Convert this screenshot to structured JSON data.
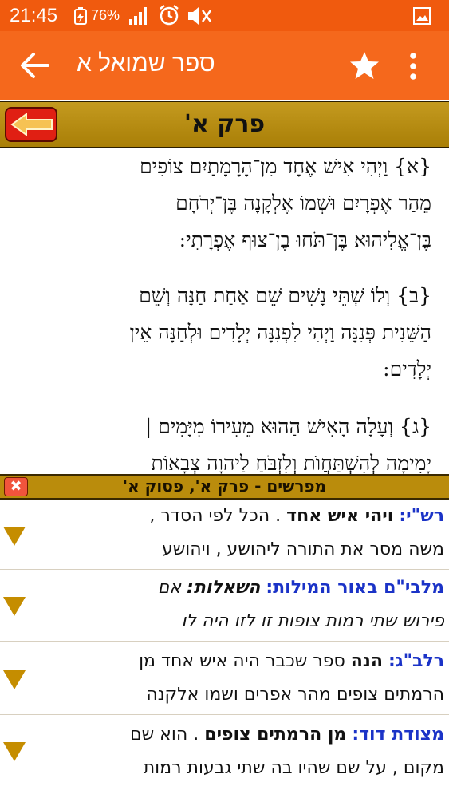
{
  "status_bar": {
    "time": "21:45",
    "battery": "76%"
  },
  "app_bar": {
    "title": "ספר שמואל א"
  },
  "chapter_bar": {
    "title": "פרק א'"
  },
  "verses": [
    {
      "lines": [
        "{א} וַיְהִי אִישׁ אֶחָד מִן־הָרָמָתַיִם צוֹפִים",
        "מֵהַר אֶפְרָיִם וּשְׁמוֹ אֶלְקָנָה בֶּן־יְרֹחָם",
        "בֶּן־אֱלִיהוּא בֶּן־תֹּחוּ בֶן־צוּף אֶפְרָתִי:"
      ]
    },
    {
      "lines": [
        "{ב} וְלוֹ שְׁתֵּי נָשִׁים שֵׁם אַחַת חַנָּה וְשֵׁם",
        "הַשֵּׁנִית פְּנִנָּה וַיְהִי לִפְנִנָּה יְלָדִים וּלְחַנָּה אֵין",
        "יְלָדִים:"
      ]
    },
    {
      "lines": [
        "{ג} וְעָלָה הָאִישׁ הַהוּא מֵעִירוֹ מִיָּמִים |",
        "יָמִימָה לְהִשְׁתַּחֲוֺת וְלִזְבֹּחַ לַיהוָה צְבָאוֹת"
      ]
    }
  ],
  "commentary_bar": {
    "title": "מפרשים - פרק א', פסוק א'"
  },
  "commentaries": [
    {
      "author": "רש\"י:",
      "headword": "ויהי איש אחד",
      "line1_rest": ". הכל לפי הסדר ,",
      "line2": "משה מסר את התורה ליהושע , ויהושע"
    },
    {
      "author": "מלבי\"ם באור המילות:",
      "headword": "השאלות:",
      "line1_rest": "אם",
      "line2": "פירוש שתי רמות צופות זו לזו היה לו"
    },
    {
      "author": "רלב\"ג:",
      "headword": "הנה",
      "line1_rest": "ספר שכבר היה איש אחד מן",
      "line2": "הרמתים צופים מהר אפרים ושמו אלקנה"
    },
    {
      "author": "מצודת דוד:",
      "headword": "מן הרמתים צופים",
      "line1_rest": ". הוא שם",
      "line2": "מקום , על שם שהיו בה שתי גבעות רמות"
    }
  ]
}
